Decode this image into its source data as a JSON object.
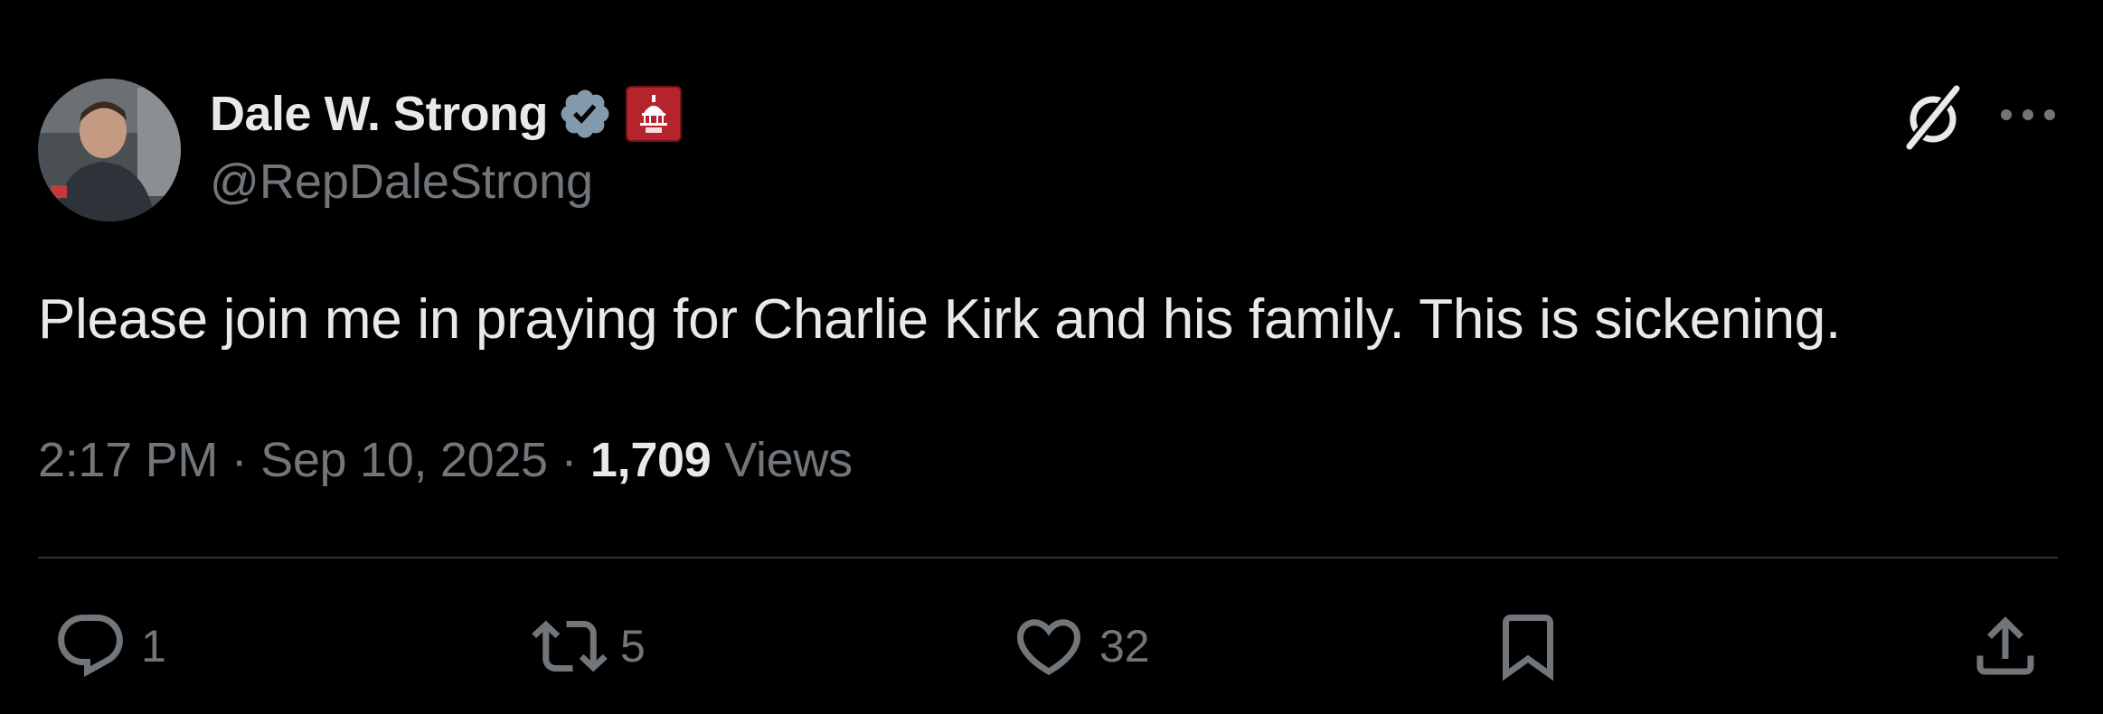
{
  "author": {
    "display_name": "Dale W. Strong",
    "handle": "@RepDaleStrong",
    "verified_badge_icon": "verified-badge-icon",
    "affiliation_badge_icon": "house-gop-badge-icon"
  },
  "tweet": {
    "text": "Please join me in praying for Charlie Kirk and his family. This is sickening.",
    "time": "2:17 PM",
    "separator": "·",
    "date": "Sep 10, 2025",
    "views_count": "1,709",
    "views_label": "Views"
  },
  "actions": {
    "reply": {
      "icon": "reply-icon",
      "count": "1"
    },
    "retweet": {
      "icon": "retweet-icon",
      "count": "5"
    },
    "like": {
      "icon": "heart-icon",
      "count": "32"
    },
    "bookmark": {
      "icon": "bookmark-icon"
    },
    "share": {
      "icon": "share-icon"
    }
  },
  "header_icons": [
    "grok-icon",
    "more-icon"
  ],
  "colors": {
    "background": "#000000",
    "primary_text": "#e7e9ea",
    "secondary_text": "#71767b",
    "divider": "#2f3336",
    "verified": "#829aab",
    "affiliation_badge": "#b3242c"
  }
}
